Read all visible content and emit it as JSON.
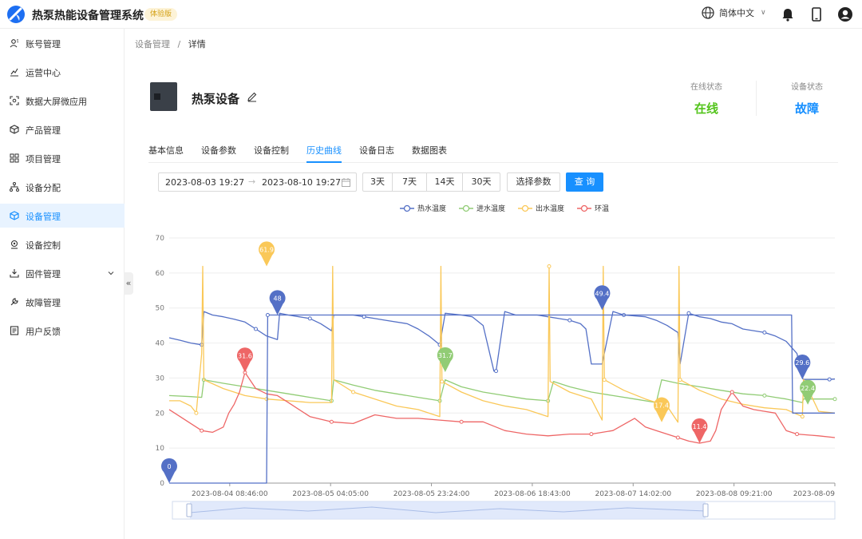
{
  "app": {
    "title": "热泵热能设备管理系统",
    "badge": "体验版"
  },
  "header": {
    "language": "简体中文",
    "language_caret": "∨"
  },
  "sidebar": {
    "items": [
      {
        "label": "账号管理",
        "icon": "user-icon"
      },
      {
        "label": "运营中心",
        "icon": "chart-line-icon"
      },
      {
        "label": "数据大屏微应用",
        "icon": "screen-scan-icon"
      },
      {
        "label": "产品管理",
        "icon": "box-icon"
      },
      {
        "label": "项目管理",
        "icon": "grid-icon"
      },
      {
        "label": "设备分配",
        "icon": "hierarchy-icon"
      },
      {
        "label": "设备管理",
        "icon": "cube-icon",
        "active": true
      },
      {
        "label": "设备控制",
        "icon": "location-icon"
      },
      {
        "label": "固件管理",
        "icon": "download-icon",
        "has_children": true
      },
      {
        "label": "故障管理",
        "icon": "wrench-icon"
      },
      {
        "label": "用户反馈",
        "icon": "feedback-icon"
      }
    ],
    "collapse_label": "«"
  },
  "breadcrumb": {
    "parent": "设备管理",
    "separator": "/",
    "current": "详情"
  },
  "device": {
    "name": "热泵设备",
    "online_label": "在线状态",
    "online_value": "在线",
    "online_color": "#52c41a",
    "device_label": "设备状态",
    "device_value": "故障",
    "device_color": "#1890ff"
  },
  "tabs": [
    {
      "label": "基本信息"
    },
    {
      "label": "设备参数"
    },
    {
      "label": "设备控制"
    },
    {
      "label": "历史曲线",
      "active": true
    },
    {
      "label": "设备日志"
    },
    {
      "label": "数据图表"
    }
  ],
  "filters": {
    "start": "2023-08-03 19:27",
    "arrow": "→",
    "end": "2023-08-10 19:27",
    "quick_ranges": [
      "3天",
      "7天",
      "14天",
      "30天"
    ],
    "select_params": "选择参数",
    "query": "查 询"
  },
  "chart_data": {
    "type": "line",
    "ylim": [
      0,
      70
    ],
    "yticks": [
      "0",
      "10",
      "20",
      "30",
      "40",
      "50",
      "60",
      "70"
    ],
    "xticks": [
      "2023-08-04 08:46:00",
      "2023-08-05 04:05:00",
      "2023-08-05 23:24:00",
      "2023-08-06 18:43:00",
      "2023-08-07 14:02:00",
      "2023-08-08 09:21:00",
      "2023-08-09"
    ],
    "legend_position": "top-center",
    "series": [
      {
        "name": "热水温度",
        "color": "#5470c6",
        "x": [
          0,
          0.1,
          0.2,
          0.3,
          0.32,
          0.4,
          0.5,
          0.6,
          0.7,
          0.8,
          0.9,
          1.0,
          1.02,
          1.1,
          1.2,
          1.3,
          1.4,
          1.5,
          1.52,
          1.6,
          1.7,
          1.8,
          1.9,
          2.0,
          2.2,
          2.3,
          2.4,
          2.5,
          2.55,
          2.7,
          2.8,
          2.9,
          3.0,
          3.02,
          3.1,
          3.2,
          3.4,
          3.5,
          3.6,
          3.7,
          3.8,
          3.85,
          3.9,
          4.0,
          4.1,
          4.2,
          4.4,
          4.5,
          4.6,
          4.7,
          4.72,
          4.8,
          4.9,
          5.0,
          5.1,
          5.2,
          5.3,
          5.5,
          5.6,
          5.7,
          5.8,
          5.85,
          5.86,
          6.1,
          6.15
        ],
        "y": [
          41.5,
          40.8,
          40,
          39.5,
          49,
          48,
          47.5,
          46.8,
          46,
          44,
          42,
          41,
          48.5,
          48,
          47.5,
          47,
          45.5,
          43.5,
          48,
          48,
          48,
          47.5,
          47,
          46.5,
          45.5,
          44,
          42,
          39.5,
          48.5,
          48,
          47.5,
          45,
          32,
          32,
          49,
          48,
          48,
          47.5,
          47,
          46.5,
          45.5,
          44,
          34,
          34,
          49,
          48,
          47.5,
          46.5,
          45,
          43,
          34,
          48.5,
          47.5,
          47,
          46,
          45.5,
          44,
          43,
          42,
          40.5,
          37,
          30,
          29.6,
          29.6,
          29.7
        ],
        "markers": [
          {
            "label": "48",
            "x": 1.0,
            "y": 48
          },
          {
            "label": "49.4",
            "x": 4.0,
            "y": 49.4
          },
          {
            "label": "29.6",
            "x": 5.85,
            "y": 29.6
          }
        ]
      },
      {
        "name": "进水温度",
        "color": "#91cc75",
        "x": [
          0,
          0.2,
          0.3,
          0.32,
          0.5,
          0.7,
          0.9,
          1.1,
          1.3,
          1.5,
          1.52,
          1.7,
          1.9,
          2.1,
          2.3,
          2.5,
          2.55,
          2.7,
          2.9,
          3.1,
          3.3,
          3.5,
          3.55,
          3.7,
          3.9,
          4.1,
          4.3,
          4.5,
          4.55,
          4.7,
          4.9,
          5.1,
          5.3,
          5.5,
          5.6,
          5.7,
          5.85,
          5.86,
          6.0,
          6.15
        ],
        "y": [
          25,
          24.7,
          24.5,
          29.5,
          28.5,
          27.5,
          26.5,
          25.5,
          24.5,
          23.5,
          29.5,
          28,
          26.5,
          25.5,
          24.5,
          23.5,
          29.5,
          27.5,
          26,
          25,
          24,
          23.5,
          29,
          27.5,
          26,
          25,
          24,
          23,
          29.5,
          28.5,
          27.5,
          26.5,
          25.5,
          25,
          24.5,
          24,
          23,
          24,
          24,
          24
        ],
        "markers": [
          {
            "label": "31.7",
            "x": 2.55,
            "y": 31.7
          },
          {
            "label": "22.4",
            "x": 5.9,
            "y": 22.4
          }
        ]
      },
      {
        "name": "出水温度",
        "color": "#fac858",
        "x": [
          0,
          0.1,
          0.2,
          0.25,
          0.3,
          0.31,
          0.32,
          0.5,
          0.7,
          0.9,
          1.1,
          1.3,
          1.5,
          1.51,
          1.52,
          1.7,
          1.9,
          2.1,
          2.3,
          2.5,
          2.51,
          2.52,
          2.7,
          2.9,
          3.1,
          3.3,
          3.5,
          3.51,
          3.52,
          3.7,
          3.9,
          4.0,
          4.01,
          4.02,
          4.2,
          4.4,
          4.6,
          4.7,
          4.71,
          4.72,
          4.9,
          5.1,
          5.3,
          5.5,
          5.7,
          5.85,
          5.86,
          6.0,
          6.15
        ],
        "y": [
          23.5,
          23.5,
          22,
          20,
          37,
          61.9,
          29.5,
          27,
          25,
          24,
          23.5,
          23,
          23,
          61.9,
          29.5,
          26,
          24,
          22,
          21,
          19,
          61.9,
          29,
          26,
          23.5,
          22,
          21,
          19,
          61.9,
          29,
          26,
          24,
          18,
          61.9,
          29.5,
          26.5,
          24,
          22,
          17.4,
          61.9,
          29.5,
          26.5,
          24,
          22.5,
          21.5,
          21,
          19,
          29.6,
          20.5,
          20
        ],
        "markers": [
          {
            "label": "61.9",
            "x": 0.9,
            "y": 61.9
          },
          {
            "label": "17.4",
            "x": 4.55,
            "y": 17.4
          }
        ]
      },
      {
        "name": "环温",
        "color": "#ee6666",
        "x": [
          0,
          0.1,
          0.2,
          0.3,
          0.4,
          0.5,
          0.55,
          0.6,
          0.65,
          0.7,
          0.8,
          0.9,
          1.0,
          1.1,
          1.3,
          1.5,
          1.7,
          1.9,
          2.1,
          2.3,
          2.5,
          2.7,
          2.9,
          3.1,
          3.3,
          3.5,
          3.7,
          3.9,
          4.1,
          4.3,
          4.4,
          4.5,
          4.6,
          4.7,
          4.8,
          4.9,
          5.0,
          5.05,
          5.1,
          5.2,
          5.3,
          5.4,
          5.5,
          5.6,
          5.7,
          5.8,
          6.0,
          6.15
        ],
        "y": [
          21,
          19,
          17,
          15,
          14.5,
          16,
          20,
          22.5,
          26,
          31.6,
          27,
          25.5,
          25,
          23,
          19,
          17.5,
          17,
          19.5,
          18.5,
          18.5,
          18,
          17.5,
          17.5,
          15,
          14,
          13.5,
          14,
          14,
          15,
          18.5,
          16,
          15,
          14,
          13,
          12,
          11.4,
          12,
          15,
          21,
          26,
          22,
          21,
          20.5,
          20,
          15,
          14,
          13.5,
          13
        ],
        "markers": [
          {
            "label": "31.6",
            "x": 0.7,
            "y": 31.6
          },
          {
            "label": "11.4",
            "x": 4.9,
            "y": 11.4
          }
        ]
      },
      {
        "name": "",
        "color": "#5470c6",
        "role": "step-line",
        "x": [
          0,
          0.7,
          0.9,
          0.91,
          5.75,
          5.76,
          6.15
        ],
        "y": [
          0,
          0,
          0,
          48,
          48,
          20,
          20
        ],
        "markers": [
          {
            "label": "0",
            "x": 0,
            "y": 0
          }
        ]
      }
    ],
    "xlim": [
      0,
      6.15
    ]
  }
}
